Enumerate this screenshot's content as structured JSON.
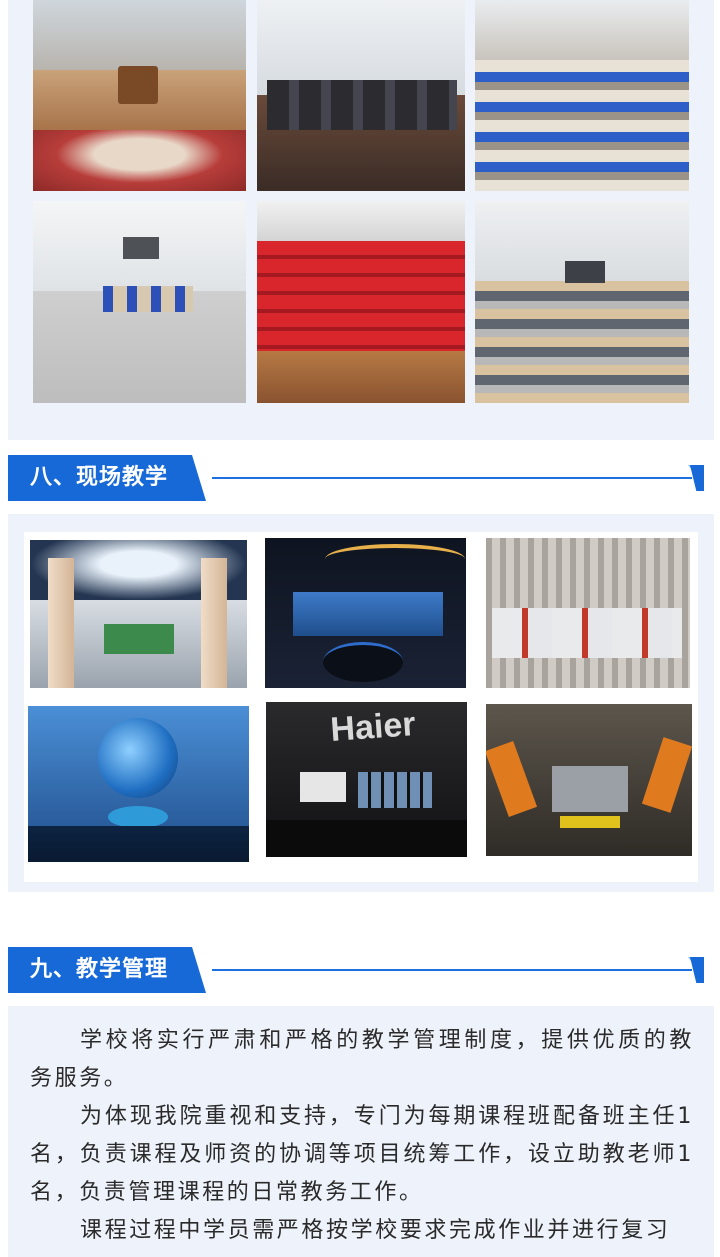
{
  "photos_top": [
    {
      "name": "photo-reception-hall",
      "caption": "reception hall with round carpet and sofas"
    },
    {
      "name": "photo-boardroom",
      "caption": "boardroom with dark leather chairs"
    },
    {
      "name": "photo-classroom-blue-chairs",
      "caption": "classroom rows with blue chairs"
    },
    {
      "name": "photo-seminar-room",
      "caption": "seminar room with group tables"
    },
    {
      "name": "photo-auditorium",
      "caption": "auditorium with red seats"
    },
    {
      "name": "photo-lecture-room",
      "caption": "lecture room with long desks"
    }
  ],
  "section8": {
    "title": "八、现场教学"
  },
  "photos_site": [
    {
      "name": "photo-exhibition-hall",
      "caption": "exhibition hall with columns"
    },
    {
      "name": "photo-haier-display",
      "caption": "Haier display area"
    },
    {
      "name": "photo-assembly-line",
      "caption": "car assembly line"
    },
    {
      "name": "photo-globe-hall",
      "caption": "globe exhibition hall"
    },
    {
      "name": "photo-haier-showroom",
      "caption": "Haier showroom",
      "logo_text": "Haier"
    },
    {
      "name": "photo-robot-workshop",
      "caption": "robot welding workshop"
    }
  ],
  "section9": {
    "title": "九、教学管理",
    "paragraphs": [
      "学校将实行严肃和严格的教学管理制度，提供优质的教务服务。",
      "为体现我院重视和支持，专门为每期课程班配备班主任1名，负责课程及师资的协调等项目统筹工作，设立助教老师1名，负责管理课程的日常教务工作。",
      "课程过程中学员需严格按学校要求完成作业并进行复习"
    ]
  },
  "colors": {
    "accent": "#1769d8",
    "panel_bg": "#eef3fb"
  }
}
